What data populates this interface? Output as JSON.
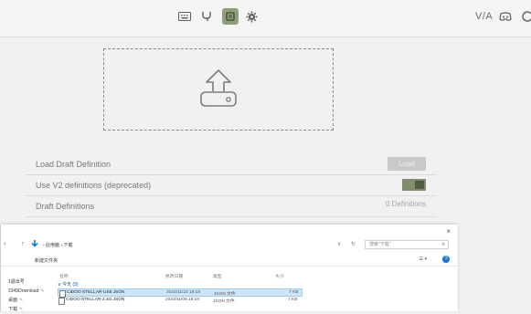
{
  "topbar": {
    "icons": [
      "keyboard-icon",
      "tree-icon",
      "package-icon",
      "gear-icon"
    ],
    "right_label": "V/A",
    "right_icons": [
      "discord-icon",
      "refresh-icon"
    ]
  },
  "dropzone": {
    "icon": "upload-icon"
  },
  "rows": {
    "load_label": "Load Draft Definition",
    "load_button": "Load",
    "v2_label": "Use V2 definitions (deprecated)",
    "v2_enabled": true,
    "draft_label": "Draft Definitions",
    "draft_count": "0 Definitions"
  },
  "explorer": {
    "close": "×",
    "breadcrumb": "› 此电脑 › 下载",
    "search_placeholder": "搜索\"下载\"",
    "new_folder": "新建文件夹",
    "view_controls": "☰ ▾",
    "help": "?",
    "sidebar": [
      {
        "label": "1退出号",
        "pinned": false
      },
      {
        "label": "2345Download",
        "pinned": true
      },
      {
        "label": "桌面",
        "pinned": true
      },
      {
        "label": "下载",
        "pinned": true
      }
    ],
    "columns": [
      "名称",
      "修改日期",
      "类型",
      "大小"
    ],
    "group": "∨ 今天 (3)",
    "files": [
      {
        "name": "CIDOO STELLAR-US8.JSON",
        "date": "2023/11/23 18:18",
        "type": "JSON 文件",
        "size": "7 KB",
        "selected": true
      },
      {
        "name": "CIDOO STELLAR-2.4G.JSON",
        "date": "2023/11/09 18:18",
        "type": "JSON 文件",
        "size": "7 KB",
        "selected": false
      }
    ]
  }
}
